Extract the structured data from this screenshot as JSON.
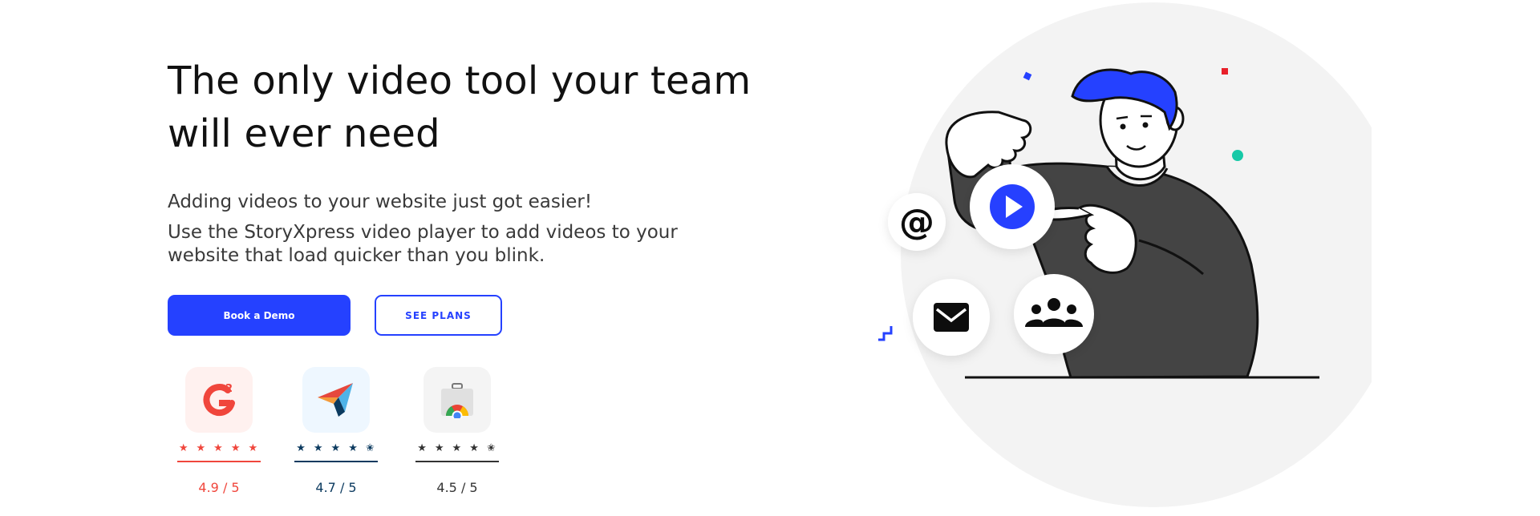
{
  "hero": {
    "title_line1": "The only video tool your team",
    "title_line2": "will ever need",
    "subtitle": "Adding videos to your website just got easier!",
    "description": "Use the StoryXpress video player to add videos to your website that load quicker than you blink."
  },
  "buttons": {
    "primary_label": "Book a Demo",
    "secondary_label": "SEE PLANS"
  },
  "ratings": [
    {
      "platform_icon": "g2-logo-icon",
      "stars": "★★★★★",
      "score": "4.9 / 5",
      "value": 4.9,
      "color": "#f0463c",
      "tile_bg": "#fff1ef"
    },
    {
      "platform_icon": "capterra-logo-icon",
      "stars": "★★★★",
      "score": "4.7 / 5",
      "value": 4.7,
      "color": "#0b3a5f",
      "tile_bg": "#eef7ff"
    },
    {
      "platform_icon": "chrome-web-store-icon",
      "stars": "★★★★",
      "score": "4.5 / 5",
      "value": 4.5,
      "color": "#333333",
      "tile_bg": "#f4f4f4"
    }
  ],
  "colors": {
    "accent": "#2541ff",
    "text": "#111111",
    "muted": "#3a3a3a",
    "illustration_dark": "#444444"
  },
  "illustration": {
    "icons": [
      "at-sign-icon",
      "play-icon",
      "mail-icon",
      "team-icon"
    ]
  }
}
